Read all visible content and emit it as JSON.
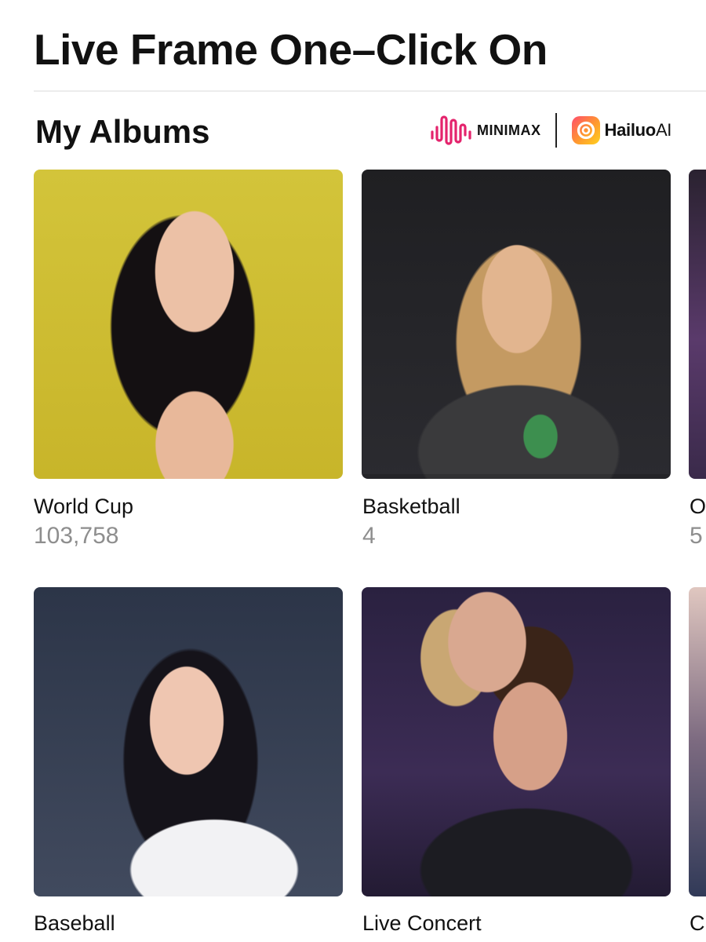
{
  "header": {
    "title": "Live Frame One–Click On"
  },
  "albums_section": {
    "title": "My Albums",
    "brands": {
      "minimax": "MINIMAX",
      "hailuo_prefix": "Hailuo",
      "hailuo_suffix": "AI"
    },
    "albums": [
      {
        "name": "World Cup",
        "count": "103,758",
        "icon": "photo-thumbnail"
      },
      {
        "name": "Basketball",
        "count": "4",
        "icon": "photo-thumbnail"
      },
      {
        "name": "O",
        "count": "5",
        "icon": "photo-thumbnail"
      },
      {
        "name": "Baseball",
        "count": "",
        "icon": "photo-thumbnail"
      },
      {
        "name": "Live Concert",
        "count": "",
        "icon": "photo-thumbnail"
      },
      {
        "name": "C",
        "count": "",
        "icon": "photo-thumbnail"
      }
    ]
  },
  "colors": {
    "title_text": "#111111",
    "count_text": "#8e8e8e",
    "divider": "#ececec",
    "minimax_logo": "#e4236c",
    "hailuo_logo_gradient": [
      "#ff4d6d",
      "#ff9a2e",
      "#ffd21f"
    ]
  }
}
